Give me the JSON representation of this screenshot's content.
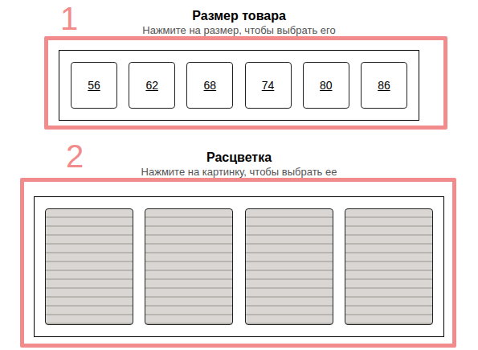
{
  "annotations": [
    "1",
    "2"
  ],
  "size_section": {
    "title": "Размер товара",
    "hint": "Нажмите на размер, чтобы выбрать его",
    "sizes": [
      {
        "label": "56"
      },
      {
        "label": "62"
      },
      {
        "label": "68"
      },
      {
        "label": "74"
      },
      {
        "label": "80"
      },
      {
        "label": "86"
      }
    ]
  },
  "color_section": {
    "title": "Расцветка",
    "hint": "Нажмите на картинку, чтобы выбрать ее",
    "swatches": [
      {
        "kind": "photo"
      },
      {
        "kind": "photo"
      },
      {
        "kind": "photo"
      },
      {
        "kind": "photo"
      }
    ]
  }
}
